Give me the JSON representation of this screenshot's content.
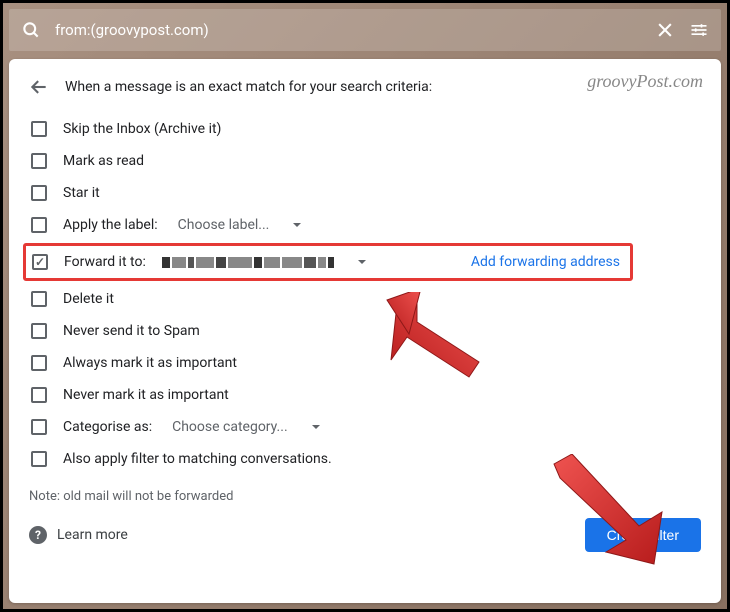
{
  "search": {
    "query": "from:(groovypost.com)"
  },
  "watermark": "groovyPost.com",
  "header": "When a message is an exact match for your search criteria:",
  "options": {
    "skip_inbox": "Skip the Inbox (Archive it)",
    "mark_read": "Mark as read",
    "star": "Star it",
    "apply_label": "Apply the label:",
    "apply_label_dropdown": "Choose label...",
    "forward": "Forward it to:",
    "forward_link": "Add forwarding address",
    "delete": "Delete it",
    "never_spam": "Never send it to Spam",
    "always_important": "Always mark it as important",
    "never_important": "Never mark it as important",
    "categorise": "Categorise as:",
    "categorise_dropdown": "Choose category...",
    "also_apply": "Also apply filter to matching conversations."
  },
  "note": "Note: old mail will not be forwarded",
  "footer": {
    "learn_more": "Learn more",
    "create_filter": "Create filter"
  }
}
